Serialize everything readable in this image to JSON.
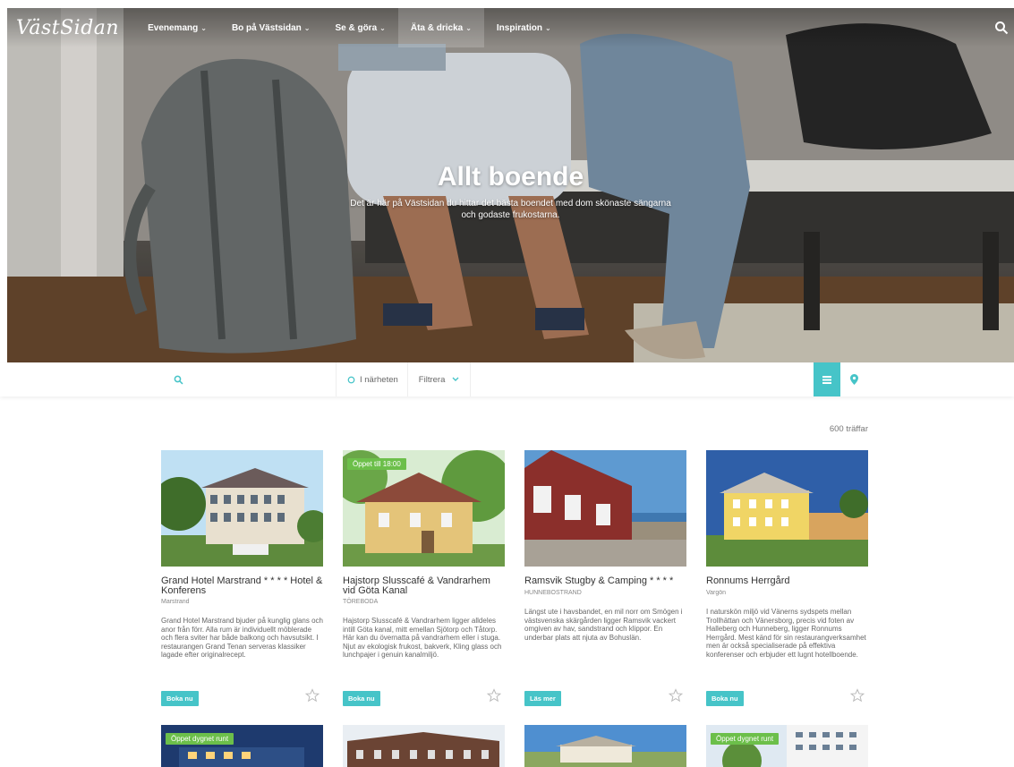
{
  "colors": {
    "accent": "#46c4c8",
    "badge": "#6cbf4a"
  },
  "nav": {
    "logo": "VästSidan",
    "items": [
      {
        "label": "Evenemang",
        "caret": "⌄"
      },
      {
        "label": "Bo på Västsidan",
        "caret": "⌄"
      },
      {
        "label": "Se & göra",
        "caret": "⌄"
      },
      {
        "label": "Äta & dricka",
        "caret": "⌄"
      },
      {
        "label": "Inspiration",
        "caret": "⌄"
      }
    ],
    "search_icon": "search-icon"
  },
  "hero": {
    "title": "Allt boende",
    "subtitle": "Det är här på Västsidan du hittar det bästa boendet med dom skönaste sängarna och godaste frukostarna."
  },
  "filterbar": {
    "search_placeholder": "",
    "nearby_label": "I närheten",
    "filter_label": "Filtrera",
    "list_icon": "list-icon",
    "map_icon": "map-pin-icon"
  },
  "results": {
    "count": "600 träffar"
  },
  "cards": [
    {
      "title": "Grand Hotel Marstrand * * * * Hotel & Konferens",
      "location": "Marstrand",
      "description": "Grand Hotel Marstrand bjuder på kunglig glans och anor från förr. Alla rum är individuellt möblerade och flera sviter har både balkong och havsutsikt. I restaurangen Grand Tenan serveras klassiker lagade efter originalrecept.",
      "button": "Boka nu",
      "badge": ""
    },
    {
      "title": "Hajstorp Slusscafé & Vandrarhem vid Göta Kanal",
      "location": "TÖREBODA",
      "description": "Hajstorp Slusscafé & Vandrarhem ligger alldeles intill Göta kanal, mitt emellan Sjötorp och Tåtorp. Här kan du övernatta på vandrarhem eller i stuga. Njut av ekologisk frukost, bakverk, Kling glass och lunchpajer i genuin kanalmiljö.",
      "button": "Boka nu",
      "badge": "Öppet till 18:00"
    },
    {
      "title": "Ramsvik Stugby & Camping * * * *",
      "location": "HUNNEBOSTRAND",
      "description": "Längst ute i havsbandet, en mil norr om Smögen i västsvenska skärgården ligger Ramsvik vackert omgiven av hav, sandstrand och klippor. En underbar plats att njuta av Bohuslän.",
      "button": "Läs mer",
      "badge": ""
    },
    {
      "title": "Ronnums Herrgård",
      "location": "Vargön",
      "description": "I naturskön miljö vid Vänerns sydspets mellan Trollhättan och Vänersborg, precis vid foten av Halleberg och Hunneberg, ligger Ronnums Herrgård. Mest känd för sin restaurangverksamhet men är också specialiserade på effektiva konferenser och erbjuder ett lugnt hotellboende.",
      "button": "Boka nu",
      "badge": ""
    }
  ],
  "row2": [
    {
      "badge": "Öppet dygnet runt"
    },
    {
      "badge": ""
    },
    {
      "badge": ""
    },
    {
      "badge": "Öppet dygnet runt"
    }
  ]
}
